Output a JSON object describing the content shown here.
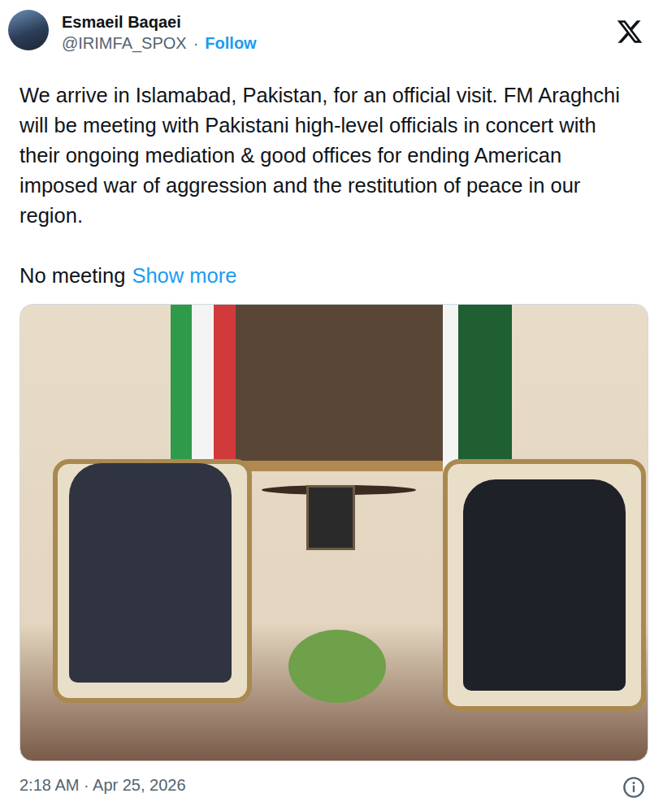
{
  "post": {
    "author": {
      "name": "Esmaeil Baqaei",
      "handle": "@IRIMFA_SPOX",
      "separator": "·",
      "follow": "Follow"
    },
    "text": "We arrive in Islamabad, Pakistan, for an official visit. FM Araghchi will be meeting with Pakistani high-level officials in concert with their ongoing mediation & good offices for ending American imposed war of aggression and the restitution of peace in our region.",
    "truncated_text": "No meeting",
    "show_more": "Show more",
    "timestamp": "2:18 AM · Apr 25, 2026"
  }
}
